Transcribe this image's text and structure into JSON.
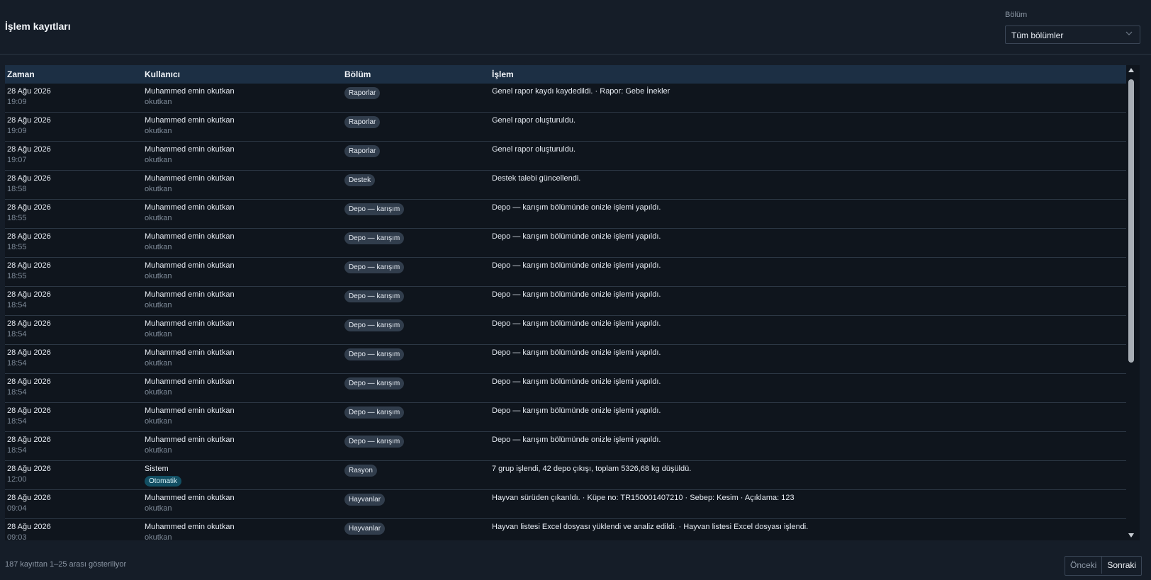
{
  "header": {
    "title": "İşlem kayıtları",
    "filter_label": "Bölüm",
    "filter_value": "Tüm bölümler"
  },
  "table": {
    "columns": [
      "Zaman",
      "Kullanıcı",
      "Bölüm",
      "İşlem"
    ],
    "rows": [
      {
        "date": "28 Ağu 2026",
        "time": "19:09",
        "user": "Muhammed emin okutkan",
        "username": "okutkan",
        "section": "Raporlar",
        "action": "Genel rapor kaydı kaydedildi. · Rapor: Gebe İnekler"
      },
      {
        "date": "28 Ağu 2026",
        "time": "19:09",
        "user": "Muhammed emin okutkan",
        "username": "okutkan",
        "section": "Raporlar",
        "action": "Genel rapor oluşturuldu."
      },
      {
        "date": "28 Ağu 2026",
        "time": "19:07",
        "user": "Muhammed emin okutkan",
        "username": "okutkan",
        "section": "Raporlar",
        "action": "Genel rapor oluşturuldu."
      },
      {
        "date": "28 Ağu 2026",
        "time": "18:58",
        "user": "Muhammed emin okutkan",
        "username": "okutkan",
        "section": "Destek",
        "action": "Destek talebi güncellendi."
      },
      {
        "date": "28 Ağu 2026",
        "time": "18:55",
        "user": "Muhammed emin okutkan",
        "username": "okutkan",
        "section": "Depo — karışım",
        "action": "Depo — karışım bölümünde onizle işlemi yapıldı."
      },
      {
        "date": "28 Ağu 2026",
        "time": "18:55",
        "user": "Muhammed emin okutkan",
        "username": "okutkan",
        "section": "Depo — karışım",
        "action": "Depo — karışım bölümünde onizle işlemi yapıldı."
      },
      {
        "date": "28 Ağu 2026",
        "time": "18:55",
        "user": "Muhammed emin okutkan",
        "username": "okutkan",
        "section": "Depo — karışım",
        "action": "Depo — karışım bölümünde onizle işlemi yapıldı."
      },
      {
        "date": "28 Ağu 2026",
        "time": "18:54",
        "user": "Muhammed emin okutkan",
        "username": "okutkan",
        "section": "Depo — karışım",
        "action": "Depo — karışım bölümünde onizle işlemi yapıldı."
      },
      {
        "date": "28 Ağu 2026",
        "time": "18:54",
        "user": "Muhammed emin okutkan",
        "username": "okutkan",
        "section": "Depo — karışım",
        "action": "Depo — karışım bölümünde onizle işlemi yapıldı."
      },
      {
        "date": "28 Ağu 2026",
        "time": "18:54",
        "user": "Muhammed emin okutkan",
        "username": "okutkan",
        "section": "Depo — karışım",
        "action": "Depo — karışım bölümünde onizle işlemi yapıldı."
      },
      {
        "date": "28 Ağu 2026",
        "time": "18:54",
        "user": "Muhammed emin okutkan",
        "username": "okutkan",
        "section": "Depo — karışım",
        "action": "Depo — karışım bölümünde onizle işlemi yapıldı."
      },
      {
        "date": "28 Ağu 2026",
        "time": "18:54",
        "user": "Muhammed emin okutkan",
        "username": "okutkan",
        "section": "Depo — karışım",
        "action": "Depo — karışım bölümünde onizle işlemi yapıldı."
      },
      {
        "date": "28 Ağu 2026",
        "time": "18:54",
        "user": "Muhammed emin okutkan",
        "username": "okutkan",
        "section": "Depo — karışım",
        "action": "Depo — karışım bölümünde onizle işlemi yapıldı."
      },
      {
        "date": "28 Ağu 2026",
        "time": "12:00",
        "user": "Sistem",
        "username": "",
        "badge": "Otomatik",
        "section": "Rasyon",
        "action": "7 grup işlendi, 42 depo çıkışı, toplam 5326,68 kg düşüldü."
      },
      {
        "date": "28 Ağu 2026",
        "time": "09:04",
        "user": "Muhammed emin okutkan",
        "username": "okutkan",
        "section": "Hayvanlar",
        "action": "Hayvan sürüden çıkarıldı. · Küpe no: TR150001407210 · Sebep: Kesim · Açıklama: 123"
      },
      {
        "date": "28 Ağu 2026",
        "time": "09:03",
        "user": "Muhammed emin okutkan",
        "username": "okutkan",
        "section": "Hayvanlar",
        "action": "Hayvan listesi Excel dosyası yüklendi ve analiz edildi. · Hayvan listesi Excel dosyası işlendi."
      }
    ]
  },
  "footer": {
    "info": "187 kayıttan 1–25 arası gösteriliyor",
    "prev_label": "Önceki",
    "next_label": "Sonraki"
  },
  "colors": {
    "background": "#151d28",
    "header_row": "#1c2f44",
    "badge": "#313d4c",
    "auto_badge": "#124f63"
  }
}
